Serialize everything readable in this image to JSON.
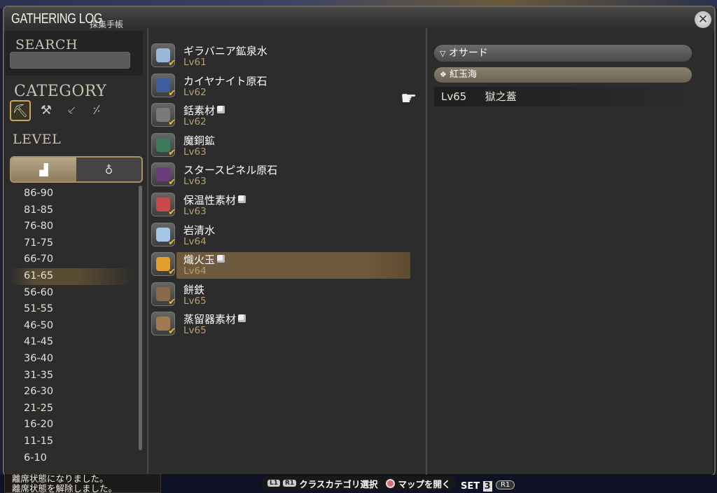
{
  "window": {
    "title": "GATHERING LOG",
    "subtitle": "採集手帳",
    "close_icon": "close-icon"
  },
  "left": {
    "search_label": "SEARCH",
    "search_value": "",
    "category_label": "CATEGORY",
    "categories": [
      {
        "icon": "pickaxe-icon",
        "selected": true
      },
      {
        "icon": "hammer-icon",
        "selected": false
      },
      {
        "icon": "hatchet-icon",
        "selected": false
      },
      {
        "icon": "scythe-icon",
        "selected": false
      }
    ],
    "level_label": "LEVEL",
    "level_modes": [
      {
        "icon": "stairs-icon",
        "selected": true
      },
      {
        "icon": "pouch-icon",
        "selected": false
      }
    ],
    "level_ranges": [
      "86-90",
      "81-85",
      "76-80",
      "71-75",
      "66-70",
      "61-65",
      "56-60",
      "51-55",
      "46-50",
      "41-45",
      "36-40",
      "31-35",
      "26-30",
      "21-25",
      "16-20",
      "11-15",
      "6-10"
    ],
    "selected_range": "61-65"
  },
  "items": [
    {
      "name": "ギラバニア鉱泉水",
      "level": "Lv61",
      "color": "#9ab7d6",
      "cube": false
    },
    {
      "name": "カイヤナイト原石",
      "level": "Lv62",
      "color": "#3f5e9c",
      "cube": false
    },
    {
      "name": "銛素材",
      "level": "Lv62",
      "color": "#7a7a7a",
      "cube": true
    },
    {
      "name": "魔銅鉱",
      "level": "Lv63",
      "color": "#3c7a5a",
      "cube": false
    },
    {
      "name": "スタースピネル原石",
      "level": "Lv63",
      "color": "#6a3a7a",
      "cube": false
    },
    {
      "name": "保温性素材",
      "level": "Lv63",
      "color": "#c84a4a",
      "cube": true
    },
    {
      "name": "岩清水",
      "level": "Lv64",
      "color": "#a6c6e6",
      "cube": false
    },
    {
      "name": "熾火玉",
      "level": "Lv64",
      "color": "#e0a030",
      "cube": true
    },
    {
      "name": "餅鉄",
      "level": "Lv65",
      "color": "#8a6a4a",
      "cube": false
    },
    {
      "name": "蒸留器素材",
      "level": "Lv65",
      "color": "#a07a50",
      "cube": true
    }
  ],
  "selected_item": "熾火玉",
  "right": {
    "region": "オサード",
    "zone": "紅玉海",
    "node_level": "Lv65",
    "node_name": "獄之蓋",
    "pointer_icon": "hand-pointer-icon"
  },
  "footer": {
    "chat_line1": "離席状態になりました。",
    "chat_line2": "離席状態を解除しました。",
    "hint1_keys": [
      "L1",
      "R1"
    ],
    "hint1_label": "クラスカテゴリ選択",
    "hint2_label": "マップを開く",
    "set_label": "SET",
    "set_number": "3",
    "r1_label": "R1"
  }
}
